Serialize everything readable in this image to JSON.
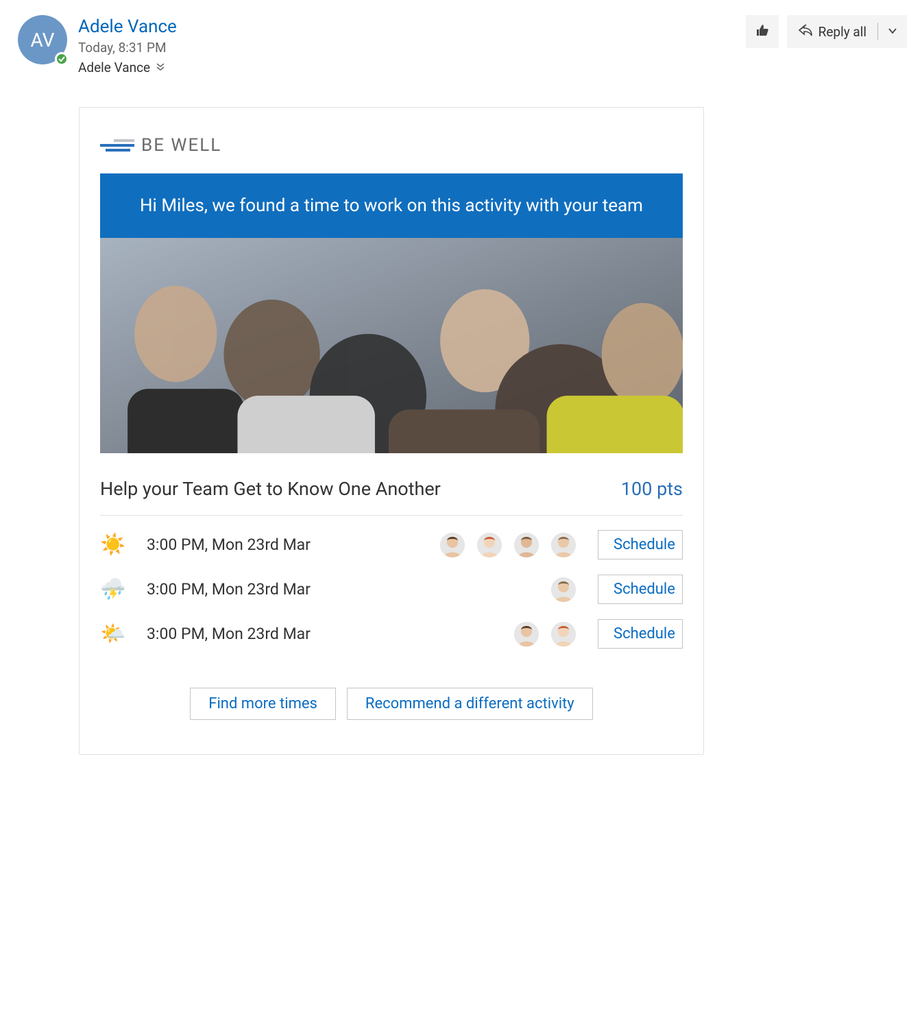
{
  "header": {
    "avatar_initials": "AV",
    "sender_name": "Adele Vance",
    "timestamp": "Today, 8:31 PM",
    "recipients": "Adele Vance",
    "reply_label": "Reply all"
  },
  "card": {
    "brand": "BE WELL",
    "hero_message": "Hi Miles, we found a time to work on this activity with your team",
    "activity_title": "Help your Team Get to Know One Another",
    "activity_points": "100 pts",
    "slots": [
      {
        "weather_icon": "sunny",
        "weather_glyph": "☀️",
        "time": "3:00 PM, Mon 23rd Mar",
        "attendee_count": 4,
        "schedule_label": "Schedule"
      },
      {
        "weather_icon": "storm",
        "weather_glyph": "⛈️",
        "time": "3:00 PM, Mon 23rd Mar",
        "attendee_count": 1,
        "schedule_label": "Schedule"
      },
      {
        "weather_icon": "partly-cloudy",
        "weather_glyph": "🌤️",
        "time": "3:00 PM, Mon 23rd Mar",
        "attendee_count": 2,
        "schedule_label": "Schedule"
      }
    ],
    "footer": {
      "find_more_label": "Find more times",
      "recommend_label": "Recommend a different activity"
    }
  }
}
